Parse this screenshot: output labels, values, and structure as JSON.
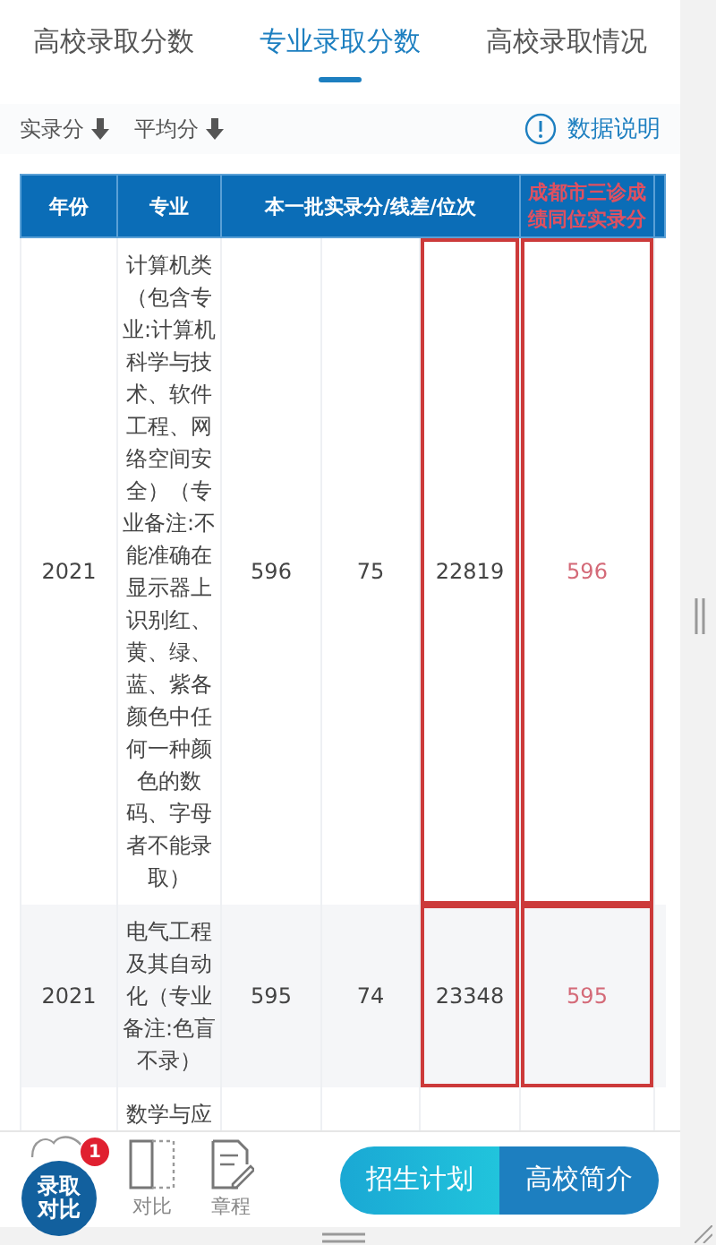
{
  "tabs": [
    {
      "label": "高校录取分数",
      "selected": false
    },
    {
      "label": "专业录取分数",
      "selected": true
    },
    {
      "label": "高校录取情况",
      "selected": false
    }
  ],
  "sort_options": [
    {
      "label": "实录分"
    },
    {
      "label": "平均分"
    }
  ],
  "info_link": "数据说明",
  "table": {
    "header": [
      {
        "label": "年份",
        "kind": "plain"
      },
      {
        "label": "专业",
        "kind": "plain"
      },
      {
        "label": "本一批实录分/线差/位次",
        "kind": "group"
      },
      {
        "label": "成都市三诊成绩同位实录分",
        "kind": "compare"
      }
    ],
    "columns": [
      {
        "highlighted": false,
        "kind": "plain"
      },
      {
        "highlighted": false,
        "kind": "plain"
      },
      {
        "highlighted": false,
        "kind": "plain"
      },
      {
        "highlighted": false,
        "kind": "plain"
      },
      {
        "highlighted": true,
        "kind": "plain"
      },
      {
        "highlighted": true,
        "kind": "compare"
      }
    ],
    "rows": [
      {
        "cells": [
          "2021",
          "计算机类（包含专业:计算机科学与技术、软件工程、网络空间安全）（专业备注:不能准确在显示器上识别红、黄、绿、蓝、紫各颜色中任何一种颜色的数码、字母者不能录取）",
          "596",
          "75",
          "22819",
          "596"
        ]
      },
      {
        "cells": [
          "2021",
          "电气工程及其自动化（专业备注:色盲不录）",
          "595",
          "74",
          "23348",
          "595"
        ]
      },
      {
        "cells": [
          null,
          "数学与应",
          null,
          null,
          null,
          null
        ]
      }
    ]
  },
  "bottom_bar": {
    "compare_badge": {
      "label": "录取对比",
      "count": "1"
    },
    "tools": [
      {
        "label": "对比",
        "kind": "compare"
      },
      {
        "label": "章程",
        "kind": "charter"
      }
    ],
    "buttons": [
      {
        "label": "招生计划",
        "kind": "primary"
      },
      {
        "label": "高校简介",
        "kind": "secondary"
      }
    ]
  }
}
